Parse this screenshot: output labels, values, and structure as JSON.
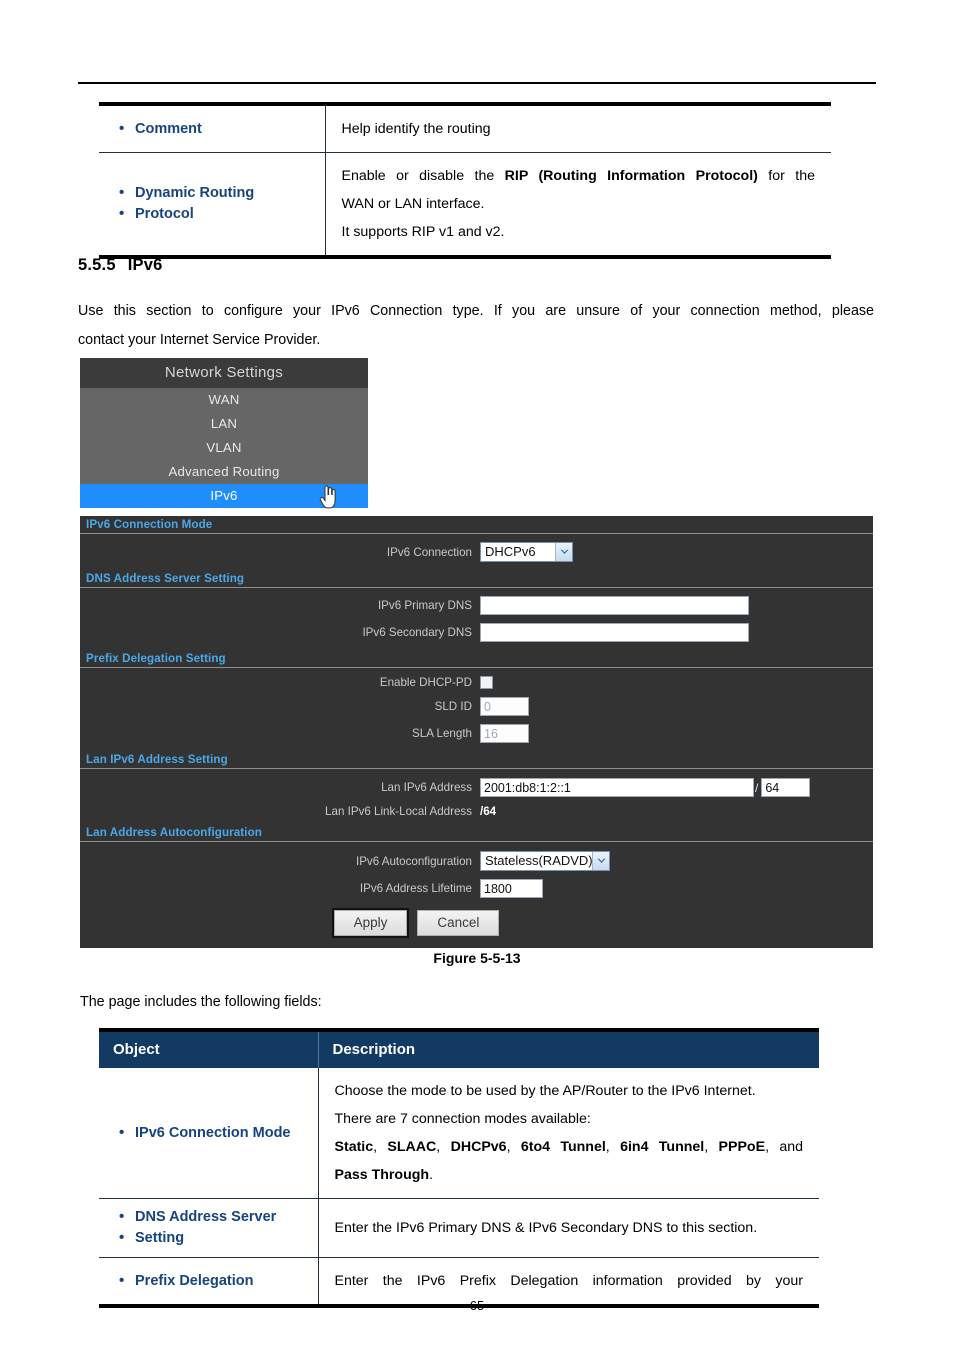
{
  "page": {
    "footer": "-65-"
  },
  "top_table": {
    "rows": [
      {
        "object": "Comment",
        "lines": [
          "Help identify the routing"
        ]
      },
      {
        "object_l1": "Dynamic Routing",
        "object_l2": "Protocol",
        "lines_html": [
          "Enable or disable the <b>RIP (Routing Information Protocol)</b> for the",
          "WAN or LAN interface.",
          "It supports RIP v1 and v2."
        ]
      }
    ]
  },
  "section": {
    "number": "5.5.5",
    "title": "IPv6",
    "paragraph_l1": "Use this section to configure your IPv6 Connection type. If you are unsure of your connection method, please",
    "paragraph_l2": "contact your Internet Service Provider."
  },
  "nav": {
    "title": "Network Settings",
    "items": [
      {
        "label": "WAN",
        "active": false
      },
      {
        "label": "LAN",
        "active": false
      },
      {
        "label": "VLAN",
        "active": false
      },
      {
        "label": "Advanced Routing",
        "active": false
      },
      {
        "label": "IPv6",
        "active": true
      }
    ],
    "cursor_icon": "hand-pointer-icon",
    "active_color": "#1f8dfb"
  },
  "panel": {
    "accent_color": "#4aa8e8",
    "background_color": "#333333",
    "sections": {
      "conn_mode": "IPv6 Connection Mode",
      "dns": "DNS Address Server Setting",
      "prefix": "Prefix Delegation Setting",
      "lan_addr": "Lan IPv6 Address Setting",
      "lan_auto": "Lan Address Autoconfiguration"
    },
    "fields": {
      "ipv6_connection_label": "IPv6 Connection",
      "ipv6_connection_value": "DHCPv6",
      "primary_dns_label": "IPv6 Primary DNS",
      "primary_dns_value": "",
      "secondary_dns_label": "IPv6 Secondary DNS",
      "secondary_dns_value": "",
      "enable_dhcp_pd_label": "Enable DHCP-PD",
      "sld_id_label": "SLD ID",
      "sld_id_value": "0",
      "sla_length_label": "SLA Length",
      "sla_length_value": "16",
      "lan_ipv6_address_label": "Lan IPv6 Address",
      "lan_ipv6_address_value": "2001:db8:1:2::1",
      "lan_ipv6_prefix_sep": "/",
      "lan_ipv6_prefix_value": "64",
      "link_local_label": "Lan IPv6 Link-Local Address",
      "link_local_value": "/64",
      "autoconf_label": "IPv6 Autoconfiguration",
      "autoconf_value": "Stateless(RADVD)",
      "lifetime_label": "IPv6 Address Lifetime",
      "lifetime_value": "1800"
    },
    "buttons": {
      "apply": "Apply",
      "cancel": "Cancel"
    }
  },
  "figure": {
    "caption": "Figure 5-5-13"
  },
  "intro": {
    "text": "The page includes the following fields:"
  },
  "bottom_table": {
    "headers": {
      "object": "Object",
      "description": "Description"
    },
    "rows": [
      {
        "object": "IPv6 Connection Mode",
        "lines_html": [
          "Choose the mode to be used by the AP/Router to the IPv6 Internet.",
          "There are 7 connection modes available:",
          "<b>Static</b>, <b>SLAAC</b>, <b>DHCPv6</b>, <b>6to4 Tunnel</b>, <b>6in4 Tunnel</b>, <b>PPPoE</b>, and",
          "<b>Pass Through</b>."
        ]
      },
      {
        "object_l1": "DNS Address Server",
        "object_l2": "Setting",
        "lines_html": [
          "Enter the IPv6 Primary DNS &amp; IPv6 Secondary DNS to this section."
        ]
      },
      {
        "object": "Prefix Delegation",
        "lines_html": [
          "Enter the IPv6 Prefix Delegation information provided by your"
        ]
      }
    ]
  }
}
